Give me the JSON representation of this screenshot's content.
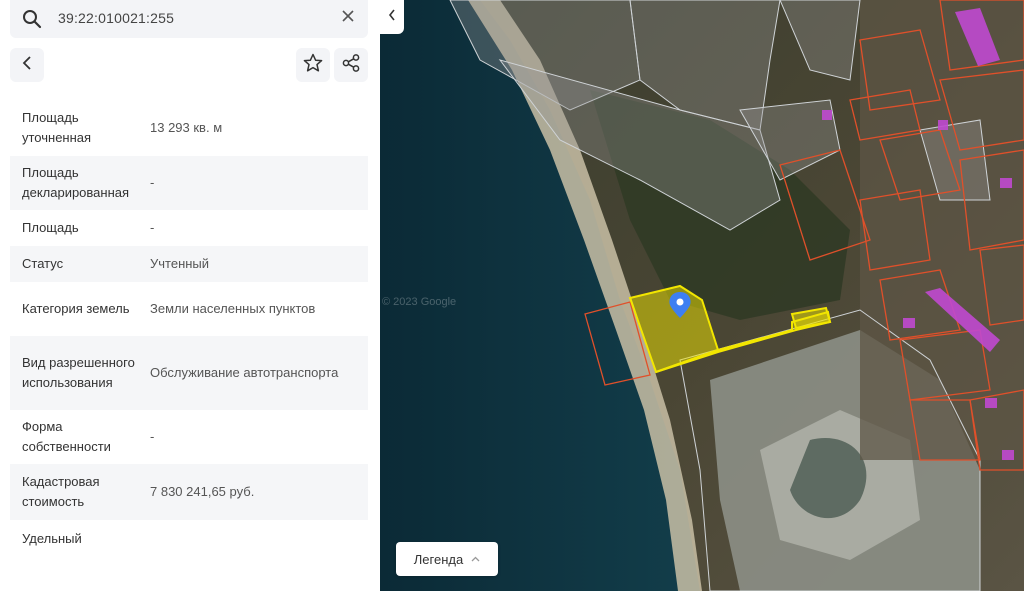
{
  "search": {
    "query": "39:22:010021:255",
    "clear_icon": "close-icon"
  },
  "header": {
    "back_icon": "chevron-left-icon",
    "favorite_icon": "star-icon",
    "share_icon": "share-icon"
  },
  "attributes": [
    {
      "label": "Площадь уточненная",
      "value": "13 293 кв. м"
    },
    {
      "label": "Площадь декларированная",
      "value": "-"
    },
    {
      "label": "Площадь",
      "value": "-"
    },
    {
      "label": "Статус",
      "value": "Учтенный"
    },
    {
      "label": "Категория земель",
      "value": "Земли населенных пунктов"
    },
    {
      "label": "Вид разрешенного использования",
      "value": "Обслуживание автотранспорта"
    },
    {
      "label": "Форма собственности",
      "value": "-"
    },
    {
      "label": "Кадастровая стоимость",
      "value": "7 830 241,65 руб."
    },
    {
      "label": "Удельный",
      "value": ""
    }
  ],
  "map": {
    "watermark": "© 2023 Google",
    "legend_label": "Легенда",
    "selected_color": "#f2e600",
    "parcel_color": "#e0502a",
    "building_color": "#c04ad0",
    "pin_color": "#3d7ff2"
  }
}
